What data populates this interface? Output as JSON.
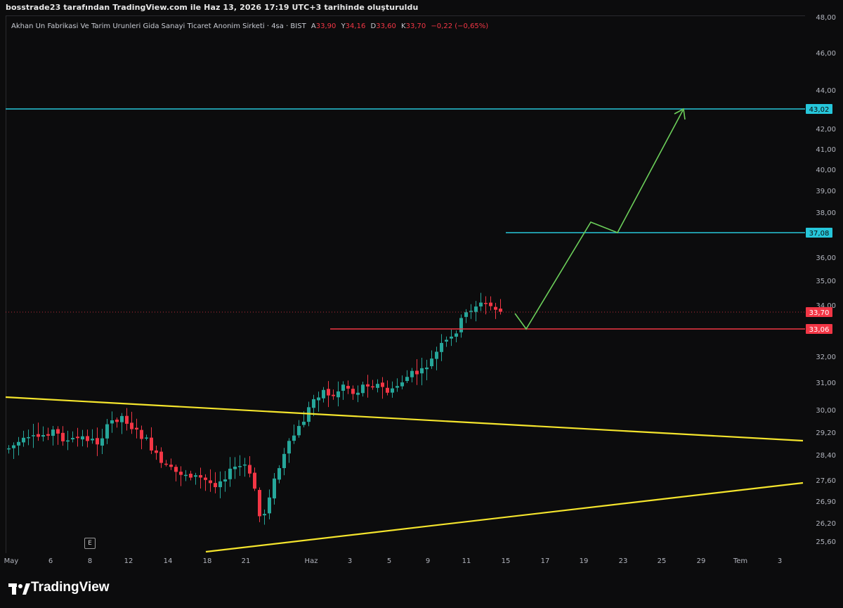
{
  "header": {
    "caption": "bosstrade23 tarafından TradingView.com ile Haz 13, 2026 17:19 UTC+3 tarihinde oluşturuldu"
  },
  "legend": {
    "symbol_name": "Akhan Un Fabrikasi Ve Tarim Urunleri Gida Sanayi Ticaret Anonim Sirketi · 4sa · BIST",
    "open_label": "A",
    "open_value": "33,90",
    "high_label": "Y",
    "high_value": "34,16",
    "low_label": "D",
    "low_value": "33,60",
    "close_label": "K",
    "close_value": "33,70",
    "change": "−0,22 (−0,65%)"
  },
  "colors": {
    "up": "#26a69a",
    "down": "#f23645",
    "cyan_level": "#26c6da",
    "red_level": "#f23645",
    "yellow_trend": "#f5e52d",
    "projection": "#6ccf5a",
    "axis_text": "#b2b5be"
  },
  "price_axis": {
    "ticks": [
      "48,00",
      "46,00",
      "44,00",
      "42,00",
      "41,00",
      "40,00",
      "39,00",
      "38,00",
      "36,00",
      "35,00",
      "34,00",
      "32,00",
      "31,00",
      "30,00",
      "29,20",
      "28,40",
      "27,60",
      "26,90",
      "26,20",
      "25,60"
    ],
    "tags": [
      {
        "label": "43,02",
        "kind": "cyan"
      },
      {
        "label": "37,08",
        "kind": "cyan"
      },
      {
        "label": "33,70",
        "kind": "red"
      },
      {
        "label": "33,06",
        "kind": "red"
      }
    ]
  },
  "time_axis": {
    "labels": [
      "May",
      "6",
      "8",
      "12",
      "14",
      "18",
      "21",
      "Haz",
      "3",
      "5",
      "9",
      "11",
      "15",
      "17",
      "19",
      "23",
      "25",
      "29",
      "Tem",
      "3"
    ]
  },
  "badge": {
    "label": "E"
  },
  "brand": {
    "name": "TradingView"
  }
}
